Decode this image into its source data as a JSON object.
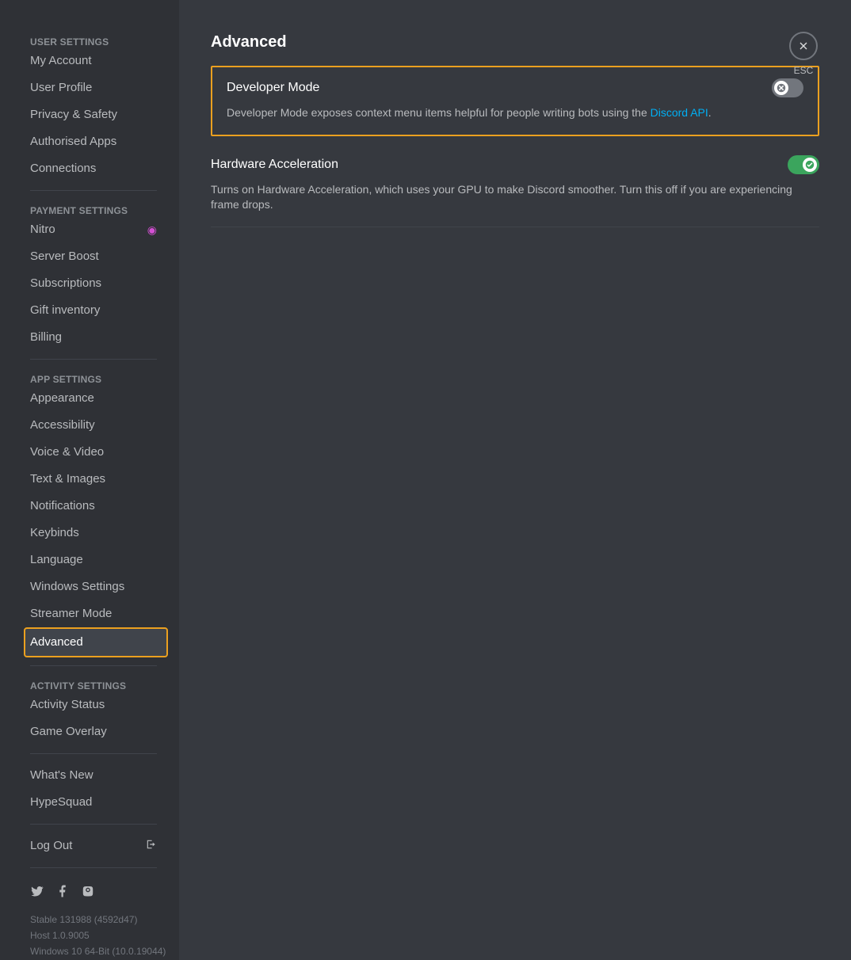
{
  "sidebar": {
    "sections": [
      {
        "header": "User Settings",
        "items": [
          {
            "label": "My Account"
          },
          {
            "label": "User Profile"
          },
          {
            "label": "Privacy & Safety"
          },
          {
            "label": "Authorised Apps"
          },
          {
            "label": "Connections"
          }
        ]
      },
      {
        "header": "Payment Settings",
        "items": [
          {
            "label": "Nitro",
            "icon": "nitro"
          },
          {
            "label": "Server Boost"
          },
          {
            "label": "Subscriptions"
          },
          {
            "label": "Gift inventory"
          },
          {
            "label": "Billing"
          }
        ]
      },
      {
        "header": "App Settings",
        "items": [
          {
            "label": "Appearance"
          },
          {
            "label": "Accessibility"
          },
          {
            "label": "Voice & Video"
          },
          {
            "label": "Text & Images"
          },
          {
            "label": "Notifications"
          },
          {
            "label": "Keybinds"
          },
          {
            "label": "Language"
          },
          {
            "label": "Windows Settings"
          },
          {
            "label": "Streamer Mode"
          },
          {
            "label": "Advanced",
            "active": true,
            "highlighted": true
          }
        ]
      },
      {
        "header": "Activity Settings",
        "items": [
          {
            "label": "Activity Status"
          },
          {
            "label": "Game Overlay"
          }
        ]
      }
    ],
    "misc": [
      {
        "label": "What's New"
      },
      {
        "label": "HypeSquad"
      }
    ],
    "logout": {
      "label": "Log Out"
    },
    "version": {
      "line1": "Stable 131988 (4592d47)",
      "line2": "Host 1.0.9005",
      "line3": "Windows 10 64-Bit (10.0.19044)"
    }
  },
  "main": {
    "title": "Advanced",
    "close_label": "ESC",
    "settings": [
      {
        "title": "Developer Mode",
        "desc_pre": "Developer Mode exposes context menu items helpful for people writing bots using the ",
        "desc_link": "Discord API",
        "desc_post": ".",
        "state": "off",
        "highlighted": true
      },
      {
        "title": "Hardware Acceleration",
        "desc": "Turns on Hardware Acceleration, which uses your GPU to make Discord smoother. Turn this off if you are experiencing frame drops.",
        "state": "on",
        "highlighted": false
      }
    ]
  }
}
